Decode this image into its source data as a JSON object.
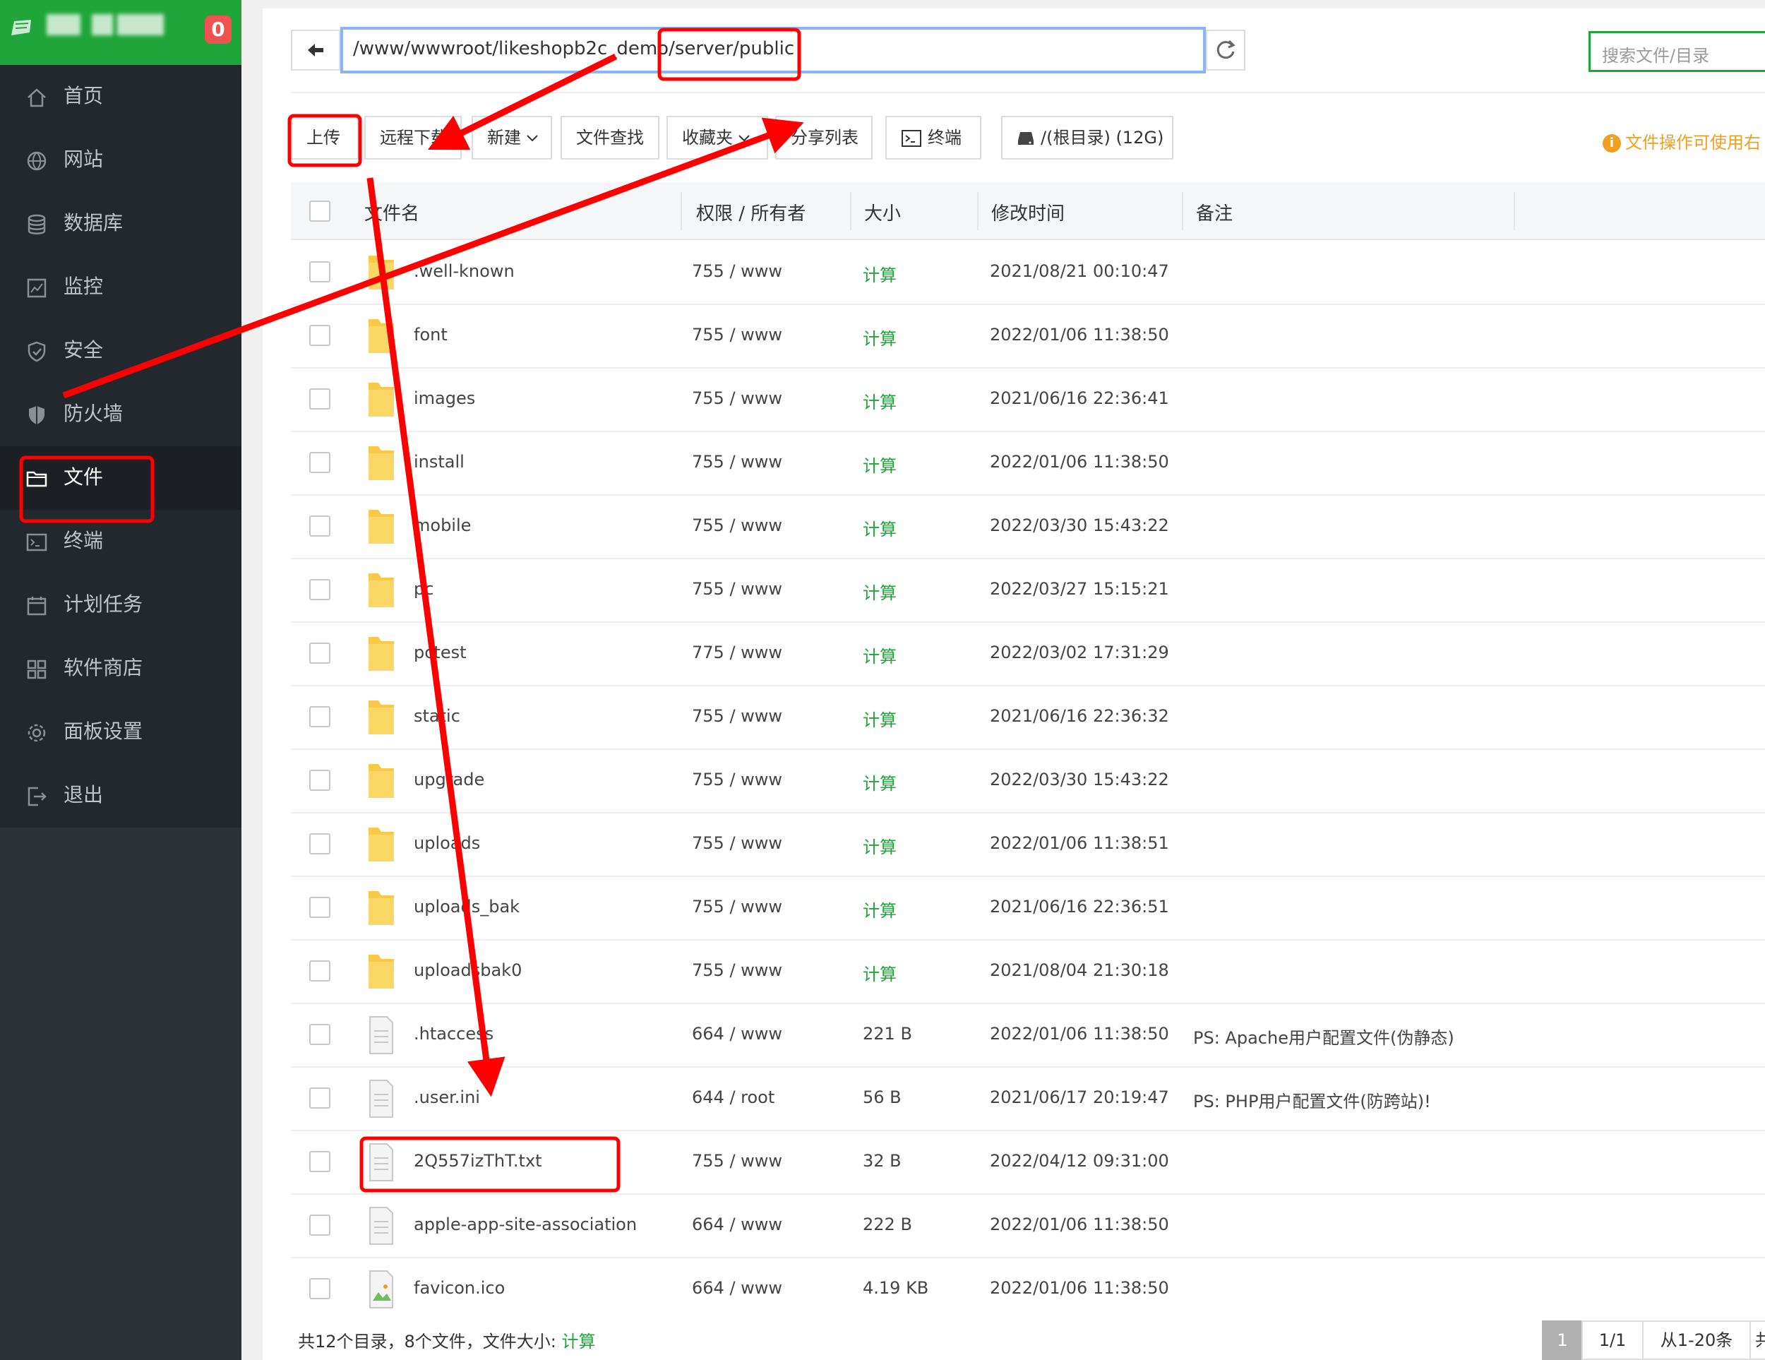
{
  "sidebar": {
    "badge": "0",
    "items": [
      {
        "label": "首页",
        "icon": "home-icon"
      },
      {
        "label": "网站",
        "icon": "globe-icon"
      },
      {
        "label": "数据库",
        "icon": "database-icon"
      },
      {
        "label": "监控",
        "icon": "monitor-icon"
      },
      {
        "label": "安全",
        "icon": "shield-icon"
      },
      {
        "label": "防火墙",
        "icon": "firewall-icon"
      },
      {
        "label": "文件",
        "icon": "folder-icon"
      },
      {
        "label": "终端",
        "icon": "terminal-icon"
      },
      {
        "label": "计划任务",
        "icon": "calendar-icon"
      },
      {
        "label": "软件商店",
        "icon": "apps-icon"
      },
      {
        "label": "面板设置",
        "icon": "gear-icon"
      },
      {
        "label": "退出",
        "icon": "logout-icon"
      }
    ],
    "active_index": 6
  },
  "toolbar": {
    "path": "/www/wwwroot/likeshopb2c_demo/server/public",
    "search_placeholder": "搜索文件/目录",
    "upload": "上传",
    "remote_download": "远程下载",
    "new": "新建",
    "file_search": "文件查找",
    "favorites": "收藏夹",
    "share_list": "分享列表",
    "terminal": "终端",
    "disk": "/(根目录) (12G)",
    "tip": "文件操作可使用右"
  },
  "table": {
    "headers": {
      "name": "文件名",
      "perm": "权限 / 所有者",
      "size": "大小",
      "mtime": "修改时间",
      "note": "备注"
    },
    "rows": [
      {
        "type": "folder",
        "name": ".well-known",
        "perm": "755 / www",
        "size": "计算",
        "mtime": "2021/08/21 00:10:47",
        "note": ""
      },
      {
        "type": "folder",
        "name": "font",
        "perm": "755 / www",
        "size": "计算",
        "mtime": "2022/01/06 11:38:50",
        "note": ""
      },
      {
        "type": "folder",
        "name": "images",
        "perm": "755 / www",
        "size": "计算",
        "mtime": "2021/06/16 22:36:41",
        "note": ""
      },
      {
        "type": "folder",
        "name": "install",
        "perm": "755 / www",
        "size": "计算",
        "mtime": "2022/01/06 11:38:50",
        "note": ""
      },
      {
        "type": "folder",
        "name": "mobile",
        "perm": "755 / www",
        "size": "计算",
        "mtime": "2022/03/30 15:43:22",
        "note": ""
      },
      {
        "type": "folder",
        "name": "pc",
        "perm": "755 / www",
        "size": "计算",
        "mtime": "2022/03/27 15:15:21",
        "note": ""
      },
      {
        "type": "folder",
        "name": "pctest",
        "perm": "775 / www",
        "size": "计算",
        "mtime": "2022/03/02 17:31:29",
        "note": ""
      },
      {
        "type": "folder",
        "name": "static",
        "perm": "755 / www",
        "size": "计算",
        "mtime": "2021/06/16 22:36:32",
        "note": ""
      },
      {
        "type": "folder",
        "name": "upgrade",
        "perm": "755 / www",
        "size": "计算",
        "mtime": "2022/03/30 15:43:22",
        "note": ""
      },
      {
        "type": "folder",
        "name": "uploads",
        "perm": "755 / www",
        "size": "计算",
        "mtime": "2022/01/06 11:38:51",
        "note": ""
      },
      {
        "type": "folder",
        "name": "uploads_bak",
        "perm": "755 / www",
        "size": "计算",
        "mtime": "2021/06/16 22:36:51",
        "note": ""
      },
      {
        "type": "folder",
        "name": "uploadsbak0",
        "perm": "755 / www",
        "size": "计算",
        "mtime": "2021/08/04 21:30:18",
        "note": ""
      },
      {
        "type": "file",
        "name": ".htaccess",
        "perm": "664 / www",
        "size": "221 B",
        "mtime": "2022/01/06 11:38:50",
        "note": "PS: Apache用户配置文件(伪静态)"
      },
      {
        "type": "file",
        "name": ".user.ini",
        "perm": "644 / root",
        "size": "56 B",
        "mtime": "2021/06/17 20:19:47",
        "note": "PS: PHP用户配置文件(防跨站)!"
      },
      {
        "type": "file",
        "name": "2Q557izThT.txt",
        "perm": "755 / www",
        "size": "32 B",
        "mtime": "2022/04/12 09:31:00",
        "note": ""
      },
      {
        "type": "file",
        "name": "apple-app-site-association",
        "perm": "664 / www",
        "size": "222 B",
        "mtime": "2022/01/06 11:38:50",
        "note": ""
      },
      {
        "type": "image",
        "name": "favicon.ico",
        "perm": "664 / www",
        "size": "4.19 KB",
        "mtime": "2022/01/06 11:38:50",
        "note": ""
      }
    ]
  },
  "footer": {
    "summary": "共12个目录，8个文件，文件大小:",
    "calc": "计算",
    "page_current": "1",
    "page_total": "1/1",
    "range": "从1-20条",
    "more": "共"
  },
  "colors": {
    "brand_green": "#20a53a",
    "annotation_red": "#ff0000",
    "sidebar_bg": "#2c3138",
    "tip_orange": "#f0a020"
  }
}
